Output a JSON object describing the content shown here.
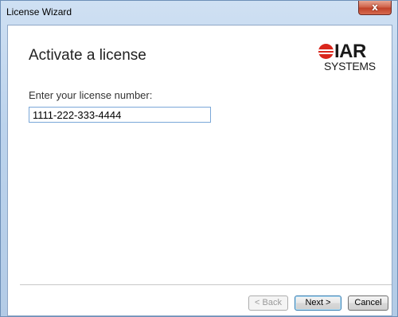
{
  "window": {
    "title": "License Wizard",
    "close_label": "x"
  },
  "header": {
    "title": "Activate a license"
  },
  "logo": {
    "brand": "IAR",
    "sub": "SYSTEMS"
  },
  "form": {
    "prompt": "Enter your license number:",
    "license_value": "1111-222-333-4444"
  },
  "buttons": {
    "back": "< Back",
    "next": "Next >",
    "cancel": "Cancel"
  },
  "colors": {
    "logo_red": "#d9261c",
    "input_border": "#7aa7d8"
  }
}
